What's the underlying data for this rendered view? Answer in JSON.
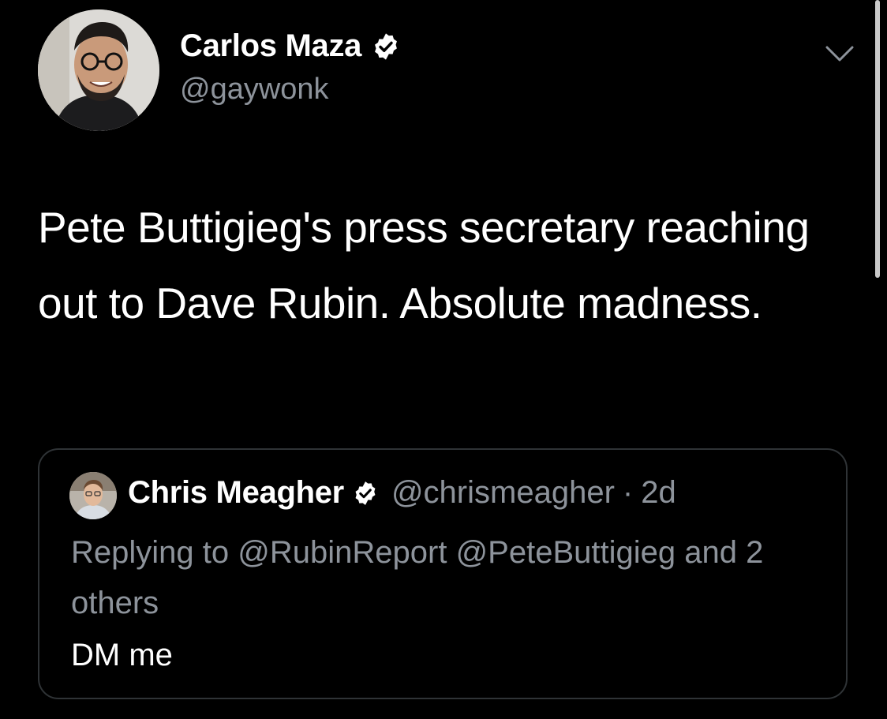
{
  "tweet": {
    "author": {
      "name": "Carlos Maza",
      "handle": "@gaywonk",
      "verified": true
    },
    "text": "Pete Buttigieg's press secretary reaching out to Dave Rubin. Absolute madness.",
    "menu_icon": "chevron-down-icon"
  },
  "quoted_tweet": {
    "author": {
      "name": "Chris Meagher",
      "handle": "@chrismeagher",
      "verified": true
    },
    "separator": "·",
    "time": "2d",
    "replying_prefix": "Replying to",
    "mentions": [
      "@RubinReport",
      "@PeteButtigieg"
    ],
    "replying_suffix": "and 2 others",
    "text": "DM me"
  },
  "colors": {
    "background": "#000000",
    "primary_text": "#ffffff",
    "secondary_text": "#8d939b",
    "card_border": "#2f3336"
  }
}
